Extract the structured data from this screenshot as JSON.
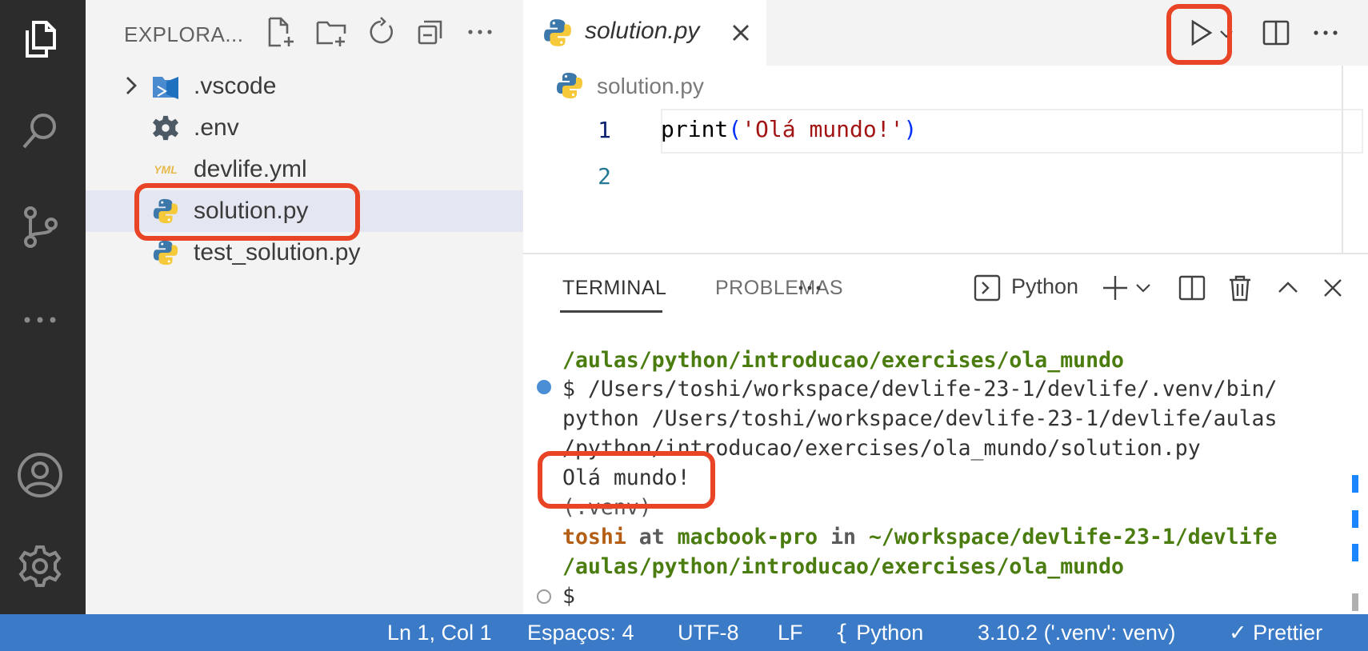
{
  "sidebar": {
    "title": "EXPLORA...",
    "items": [
      {
        "label": ".vscode"
      },
      {
        "label": ".env"
      },
      {
        "label": "devlife.yml",
        "yml_badge": "YML"
      },
      {
        "label": "solution.py"
      },
      {
        "label": "test_solution.py"
      }
    ]
  },
  "editor": {
    "tab_label": "solution.py",
    "breadcrumb": "solution.py",
    "line_numbers": [
      "1",
      "2"
    ],
    "code": {
      "fn": "print",
      "open": "(",
      "str": "'Olá mundo!'",
      "close": ")"
    }
  },
  "panel": {
    "tabs": [
      {
        "label": "TERMINAL"
      },
      {
        "label": "PROBLEMAS"
      }
    ],
    "terminal_name": "Python"
  },
  "terminal": {
    "path_tail": "/aulas/python/introducao/exercises/ola_mundo",
    "cmd1": "$ /Users/toshi/workspace/devlife-23-1/devlife/.venv/bin/",
    "cmd2": "python /Users/toshi/workspace/devlife-23-1/devlife/aulas",
    "cmd3": "/python/introducao/exercises/ola_mundo/solution.py",
    "output": "Olá mundo!",
    "venv": "(.venv)",
    "prompt_user": "toshi",
    "prompt_at": " at ",
    "prompt_host": "macbook-pro",
    "prompt_in": " in ",
    "prompt_path": "~/workspace/devlife-23-1/devlife",
    "prompt_path2": "/aulas/python/introducao/exercises/ola_mundo",
    "prompt_symbol": "$"
  },
  "status_bar": {
    "position": "Ln 1, Col 1",
    "indent": "Espaços: 4",
    "encoding": "UTF-8",
    "eol": "LF",
    "language": "Python",
    "interpreter": "3.10.2 ('.venv': venv)",
    "formatter": "Prettier"
  },
  "colors": {
    "activity_bar": "#2c2c2c",
    "sidebar_bg": "#f3f3f3",
    "selected_item": "#e4e6f1",
    "status_bar": "#3a7ac7",
    "highlight": "#ea4426",
    "terminal_green": "#4b7c0f",
    "terminal_orange": "#b35e14"
  }
}
